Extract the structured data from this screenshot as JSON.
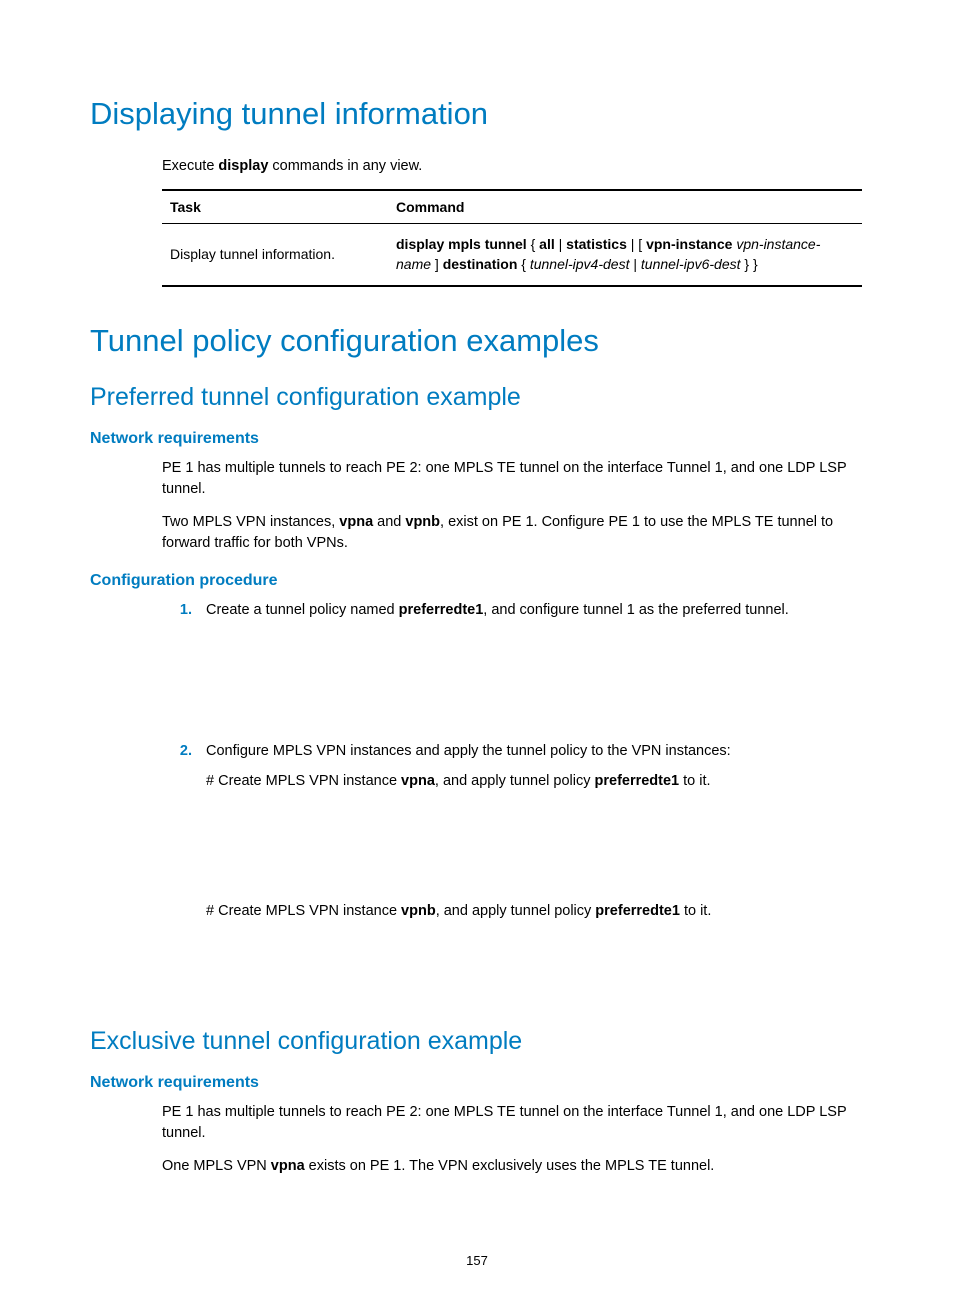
{
  "section1": {
    "title": "Displaying tunnel information",
    "intro_pre": "Execute ",
    "intro_bold": "display",
    "intro_post": " commands in any view."
  },
  "table": {
    "header_task": "Task",
    "header_command": "Command",
    "row1_task": "Display tunnel information.",
    "cmd": {
      "p1": "display mpls tunnel",
      "p2": " { ",
      "p3": "all",
      "p4": " | ",
      "p5": "statistics",
      "p6": " | [ ",
      "p7": "vpn-instance",
      "p8": " ",
      "p9": "vpn-instance-name",
      "p10": " ] ",
      "p11": "destination",
      "p12": " { ",
      "p13": "tunnel-ipv4-dest",
      "p14": " | ",
      "p15": "tunnel-ipv6-dest",
      "p16": " } }"
    }
  },
  "section2": {
    "title": "Tunnel policy configuration examples"
  },
  "preferred": {
    "title": "Preferred tunnel configuration example",
    "netreq_title": "Network requirements",
    "netreq_p1": "PE 1 has multiple tunnels to reach PE 2: one MPLS TE tunnel on the interface Tunnel 1, and one LDP LSP tunnel.",
    "netreq_p2_a": "Two MPLS VPN instances, ",
    "netreq_p2_b": "vpna",
    "netreq_p2_c": " and ",
    "netreq_p2_d": "vpnb",
    "netreq_p2_e": ", exist on PE 1. Configure PE 1 to use the MPLS TE tunnel to forward traffic for both VPNs.",
    "cfg_title": "Configuration procedure",
    "step1_num": "1.",
    "step1_a": "Create a tunnel policy named ",
    "step1_b": "preferredte1",
    "step1_c": ", and configure tunnel 1 as the preferred tunnel.",
    "step2_num": "2.",
    "step2_line1": "Configure MPLS VPN instances and apply the tunnel policy to the VPN instances:",
    "step2_l2_a": "# Create MPLS VPN instance ",
    "step2_l2_b": "vpna",
    "step2_l2_c": ", and apply tunnel policy ",
    "step2_l2_d": "preferredte1",
    "step2_l2_e": " to it.",
    "step2_l3_a": "# Create MPLS VPN instance ",
    "step2_l3_b": "vpnb",
    "step2_l3_c": ", and apply tunnel policy ",
    "step2_l3_d": "preferredte1",
    "step2_l3_e": " to it."
  },
  "exclusive": {
    "title": "Exclusive tunnel configuration example",
    "netreq_title": "Network requirements",
    "netreq_p1": "PE 1 has multiple tunnels to reach PE 2: one MPLS TE tunnel on the interface Tunnel 1, and one LDP LSP tunnel.",
    "netreq_p2_a": "One MPLS VPN ",
    "netreq_p2_b": "vpna",
    "netreq_p2_c": " exists on PE 1. The VPN exclusively uses the MPLS TE tunnel."
  },
  "page_number": "157"
}
